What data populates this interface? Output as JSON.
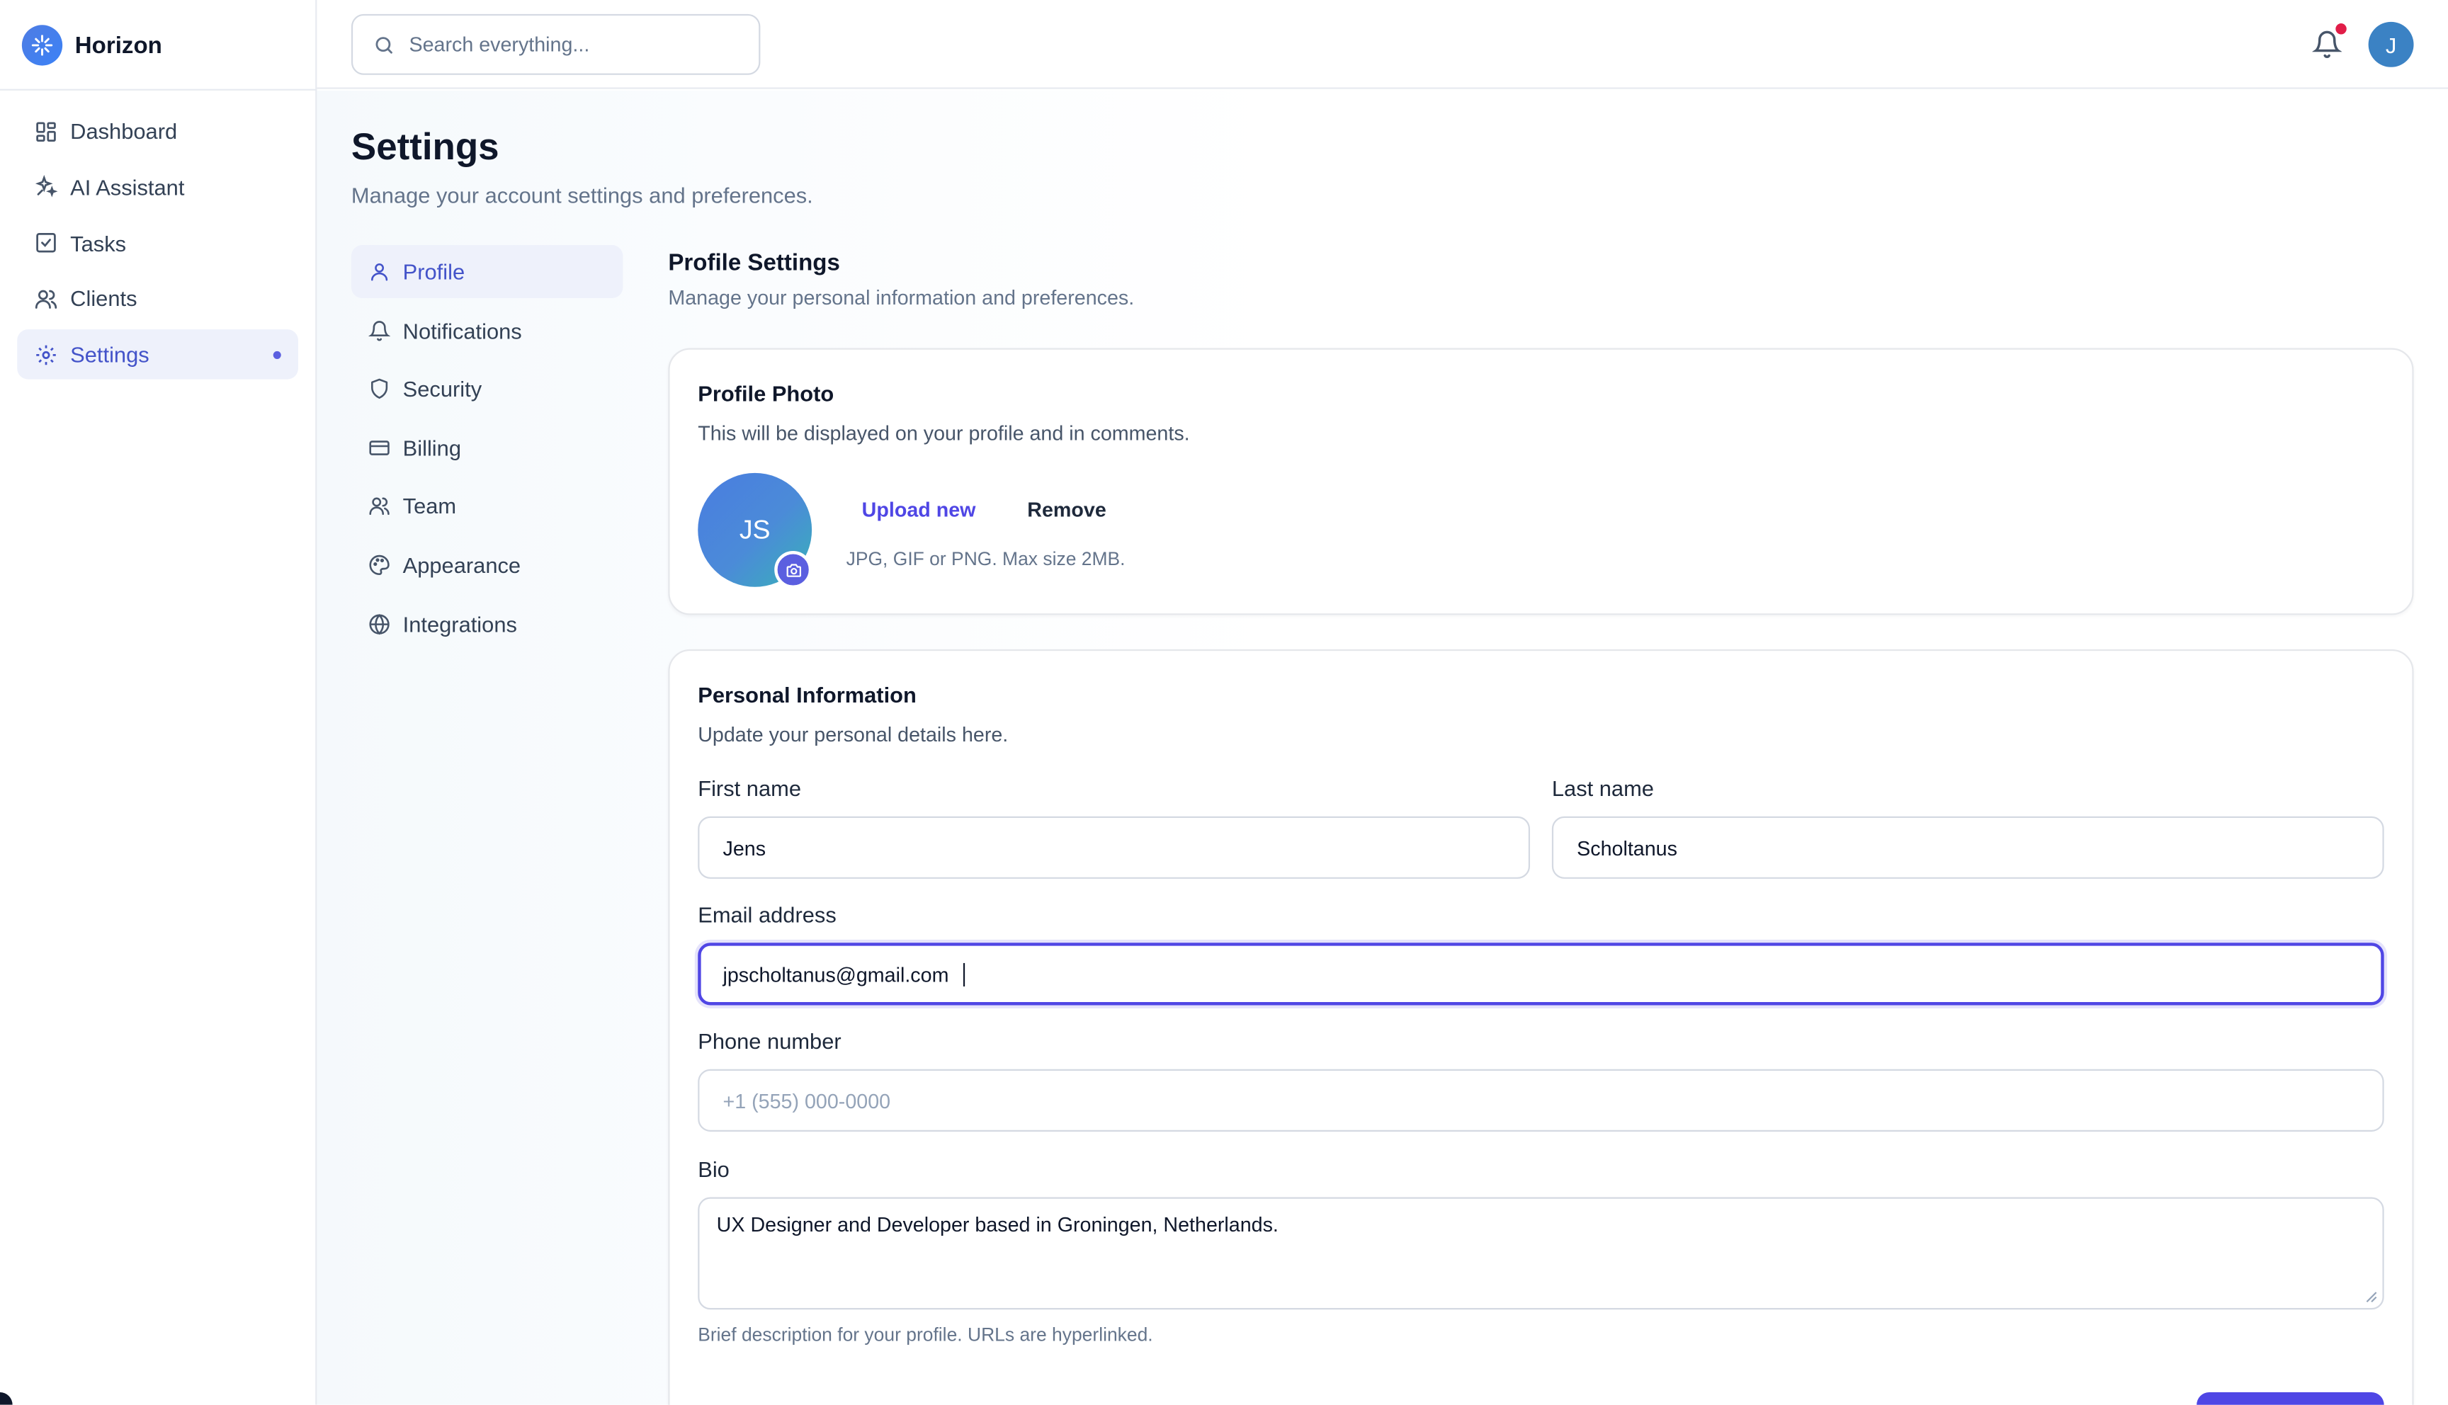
{
  "app": {
    "name": "Horizon",
    "logo_icon": "sparkle-logo-icon"
  },
  "sidebar": {
    "items": [
      {
        "label": "Dashboard",
        "icon": "dashboard-icon"
      },
      {
        "label": "AI Assistant",
        "icon": "sparkle-icon"
      },
      {
        "label": "Tasks",
        "icon": "check-square-icon"
      },
      {
        "label": "Clients",
        "icon": "users-icon"
      },
      {
        "label": "Settings",
        "icon": "gear-icon",
        "active": true,
        "indicator": true
      }
    ]
  },
  "topbar": {
    "search_placeholder": "Search everything...",
    "notification_badge": true,
    "user_initial": "J"
  },
  "page": {
    "title": "Settings",
    "subtitle": "Manage your account settings and preferences."
  },
  "settings_nav": {
    "items": [
      {
        "label": "Profile",
        "icon": "user-icon",
        "active": true
      },
      {
        "label": "Notifications",
        "icon": "bell-icon"
      },
      {
        "label": "Security",
        "icon": "shield-icon"
      },
      {
        "label": "Billing",
        "icon": "credit-card-icon"
      },
      {
        "label": "Team",
        "icon": "team-icon"
      },
      {
        "label": "Appearance",
        "icon": "palette-icon"
      },
      {
        "label": "Integrations",
        "icon": "globe-icon"
      }
    ]
  },
  "profile": {
    "title": "Profile Settings",
    "subtitle": "Manage your personal information and preferences.",
    "photo_card": {
      "title": "Profile Photo",
      "subtitle": "This will be displayed on your profile and in comments.",
      "initials": "JS",
      "upload_label": "Upload new",
      "remove_label": "Remove",
      "hint": "JPG, GIF or PNG. Max size 2MB."
    },
    "personal": {
      "title": "Personal Information",
      "subtitle": "Update your personal details here.",
      "first_name": {
        "label": "First name",
        "value": "Jens"
      },
      "last_name": {
        "label": "Last name",
        "value": "Scholtanus"
      },
      "email": {
        "label": "Email address",
        "value": "jpscholtanus@gmail.com"
      },
      "phone": {
        "label": "Phone number",
        "value": "",
        "placeholder": "+1 (555) 000-0000"
      },
      "bio": {
        "label": "Bio",
        "value": "UX Designer and Developer based in Groningen, Netherlands.",
        "help": "Brief description for your profile. URLs are hyperlinked."
      }
    }
  },
  "colors": {
    "accent": "#4f46e5",
    "active_bg": "#eef1fb",
    "active_text": "#4353c9",
    "notification_dot": "#e11d48",
    "avatar": "#3b82c4"
  }
}
